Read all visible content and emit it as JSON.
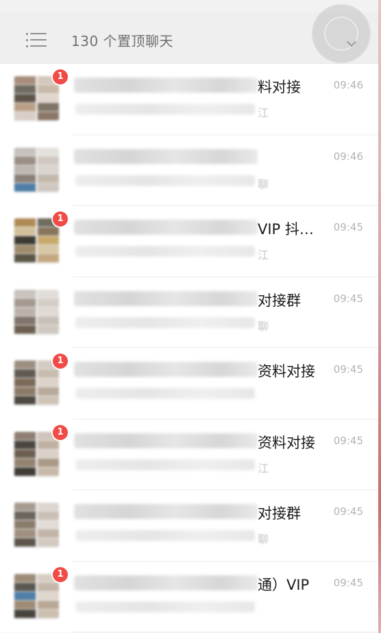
{
  "header": {
    "title": "130 个置顶聊天",
    "menu_icon": "list-icon",
    "collapse_icon": "chevron-down-icon"
  },
  "colors": {
    "badge": "#f04b46",
    "header_bg": "#efefef",
    "row_bg": "#ffffff"
  },
  "chats": [
    {
      "name_tail": "料对接",
      "preview_tail": "江",
      "time": "09:46",
      "unread": "1"
    },
    {
      "name_tail": "",
      "preview_tail": "聊",
      "time": "09:46",
      "unread": ""
    },
    {
      "name_tail": "VIP 抖…",
      "preview_tail": "江",
      "time": "09:45",
      "unread": "1"
    },
    {
      "name_tail": "对接群",
      "preview_tail": "聊",
      "time": "09:45",
      "unread": ""
    },
    {
      "name_tail": "资料对接",
      "preview_tail": "",
      "time": "09:45",
      "unread": "1"
    },
    {
      "name_tail": "资料对接",
      "preview_tail": "江",
      "time": "09:45",
      "unread": "1"
    },
    {
      "name_tail": "对接群",
      "preview_tail": "聊",
      "time": "09:45",
      "unread": ""
    },
    {
      "name_tail": "通）VIP",
      "preview_tail": "",
      "time": "09:45",
      "unread": "1"
    }
  ]
}
